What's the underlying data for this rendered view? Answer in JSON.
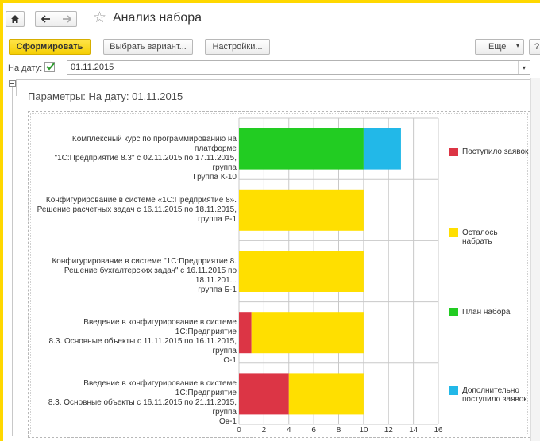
{
  "window": {
    "title": "Анализ набора"
  },
  "toolbar": {
    "generate_label": "Сформировать",
    "variant_label": "Выбрать вариант...",
    "settings_label": "Настройки...",
    "more_label": "Еще",
    "help_label": "?"
  },
  "date_filter": {
    "label": "На дату:",
    "value": "01.11.2015",
    "checked": true
  },
  "params": {
    "text": "Параметры:   На дату: 01.11.2015"
  },
  "colors": {
    "received": "#dc3545",
    "remaining": "#ffdf00",
    "plan": "#22cc22",
    "extra": "#22b8e8"
  },
  "chart_data": {
    "type": "bar",
    "orientation": "horizontal",
    "stacked": true,
    "xlim": [
      0,
      16
    ],
    "xticks": [
      0,
      2,
      4,
      6,
      8,
      10,
      12,
      14,
      16
    ],
    "grid": true,
    "legend_position": "right",
    "categories": [
      "Комплексный курс по программированию на платформе \"1С:Предприятие 8.3\" с 02.11.2015 по 17.11.2015, группа Группа К-10",
      "Конфигурирование в системе «1С:Предприятие 8». Решение расчетных задач с 16.11.2015 по 18.11.2015, группа Р-1",
      "Конфигурирование в системе \"1С:Предприятие 8. Решение бухгалтерских задач\" с 16.11.2015 по 18.11.201... группа Б-1",
      "Введение в конфигурирование в системе 1С:Предприятие 8.3. Основные объекты с 11.11.2015 по 16.11.2015, группа О-1",
      "Введение в конфигурирование в системе 1С:Предприятие 8.3. Основные объекты с 16.11.2015 по 21.11.2015, группа Ов-1"
    ],
    "category_lines": [
      [
        "Комплексный курс по программированию на платформе",
        "\"1С:Предприятие 8.3\" с 02.11.2015 по 17.11.2015, группа",
        "Группа К-10"
      ],
      [
        "Конфигурирование в системе «1С:Предприятие 8».",
        "Решение расчетных задач с 16.11.2015 по 18.11.2015,",
        "группа Р-1"
      ],
      [
        "Конфигурирование в системе \"1С:Предприятие 8.",
        "Решение бухгалтерских задач\" с 16.11.2015 по 18.11.201...",
        "группа Б-1"
      ],
      [
        "Введение в конфигурирование в системе 1С:Предприятие",
        "8.3. Основные объекты с 11.11.2015 по 16.11.2015, группа",
        "О-1"
      ],
      [
        "Введение в конфигурирование в системе 1С:Предприятие",
        "8.3. Основные объекты с 16.11.2015 по 21.11.2015, группа",
        "Ов-1"
      ]
    ],
    "series": [
      {
        "name": "Поступило заявок",
        "color": "#dc3545",
        "values": [
          0,
          0,
          0,
          1,
          4
        ]
      },
      {
        "name": "Осталось набрать",
        "color": "#ffdf00",
        "values": [
          0,
          10,
          10,
          9,
          6
        ]
      },
      {
        "name": "План набора",
        "color": "#22cc22",
        "values": [
          10,
          0,
          0,
          0,
          0
        ]
      },
      {
        "name": "Дополнительно поступило заявок",
        "color": "#22b8e8",
        "values": [
          3,
          0,
          0,
          0,
          0
        ]
      }
    ]
  }
}
